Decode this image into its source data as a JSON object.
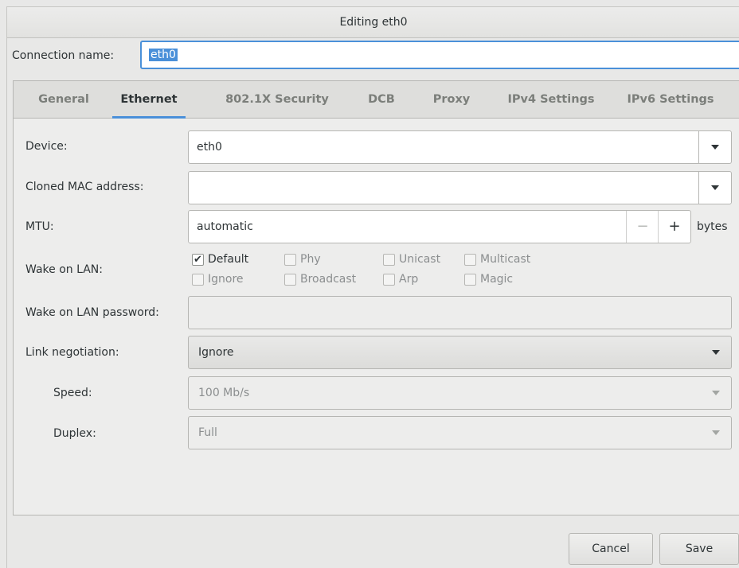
{
  "window": {
    "title": "Editing eth0"
  },
  "connection": {
    "label": "Connection name:",
    "value": "eth0"
  },
  "tabs": [
    {
      "label": "General"
    },
    {
      "label": "Ethernet"
    },
    {
      "label": "802.1X Security"
    },
    {
      "label": "DCB"
    },
    {
      "label": "Proxy"
    },
    {
      "label": "IPv4 Settings"
    },
    {
      "label": "IPv6 Settings"
    }
  ],
  "active_tab": "Ethernet",
  "form": {
    "device": {
      "label": "Device:",
      "value": "eth0"
    },
    "cloned_mac": {
      "label": "Cloned MAC address:",
      "value": ""
    },
    "mtu": {
      "label": "MTU:",
      "value": "automatic",
      "minus": "−",
      "plus": "+",
      "unit": "bytes"
    },
    "wol": {
      "label": "Wake on LAN:",
      "options": [
        {
          "label": "Default",
          "checked": true
        },
        {
          "label": "Phy",
          "checked": false
        },
        {
          "label": "Unicast",
          "checked": false
        },
        {
          "label": "Multicast",
          "checked": false
        },
        {
          "label": "Ignore",
          "checked": false
        },
        {
          "label": "Broadcast",
          "checked": false
        },
        {
          "label": "Arp",
          "checked": false
        },
        {
          "label": "Magic",
          "checked": false
        }
      ]
    },
    "wol_password": {
      "label": "Wake on LAN password:",
      "value": ""
    },
    "link_negotiation": {
      "label": "Link negotiation:",
      "value": "Ignore"
    },
    "speed": {
      "label": "Speed:",
      "value": "100 Mb/s"
    },
    "duplex": {
      "label": "Duplex:",
      "value": "Full"
    }
  },
  "buttons": {
    "cancel": "Cancel",
    "save": "Save"
  },
  "icons": {
    "checkmark": "✔",
    "dropdown": "caret-down-icon"
  },
  "colors": {
    "accent": "#4a90d9",
    "background": "#e8e8e7"
  }
}
